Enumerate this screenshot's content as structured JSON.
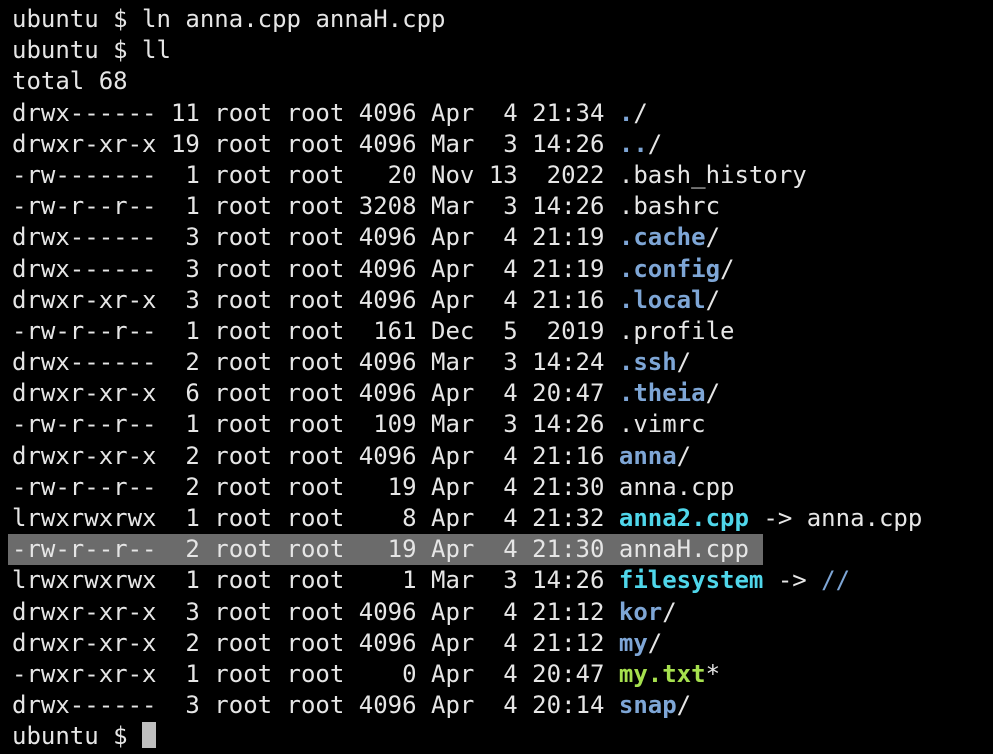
{
  "terminal": {
    "prompt": "ubuntu $",
    "commands": [
      "ln anna.cpp annaH.cpp",
      "ll"
    ],
    "total": "total 68",
    "colors": {
      "background": "#000000",
      "text": "#e6e6e6",
      "directory": "#7ea6d6",
      "symlink": "#4fd6ea",
      "executable": "#a6e04e",
      "selection": "#6b6b6b"
    },
    "entries": [
      {
        "meta": "drwx------ 11 root root 4096 Apr  4 21:34 ",
        "name": ".",
        "suffix": "/",
        "type": "dir"
      },
      {
        "meta": "drwxr-xr-x 19 root root 4096 Mar  3 14:26 ",
        "name": "..",
        "suffix": "/",
        "type": "dir"
      },
      {
        "meta": "-rw-------  1 root root   20 Nov 13  2022 ",
        "name": ".bash_history",
        "suffix": "",
        "type": "file"
      },
      {
        "meta": "-rw-r--r--  1 root root 3208 Mar  3 14:26 ",
        "name": ".bashrc",
        "suffix": "",
        "type": "file"
      },
      {
        "meta": "drwx------  3 root root 4096 Apr  4 21:19 ",
        "name": ".cache",
        "suffix": "/",
        "type": "dir"
      },
      {
        "meta": "drwx------  3 root root 4096 Apr  4 21:19 ",
        "name": ".config",
        "suffix": "/",
        "type": "dir"
      },
      {
        "meta": "drwxr-xr-x  3 root root 4096 Apr  4 21:16 ",
        "name": ".local",
        "suffix": "/",
        "type": "dir"
      },
      {
        "meta": "-rw-r--r--  1 root root  161 Dec  5  2019 ",
        "name": ".profile",
        "suffix": "",
        "type": "file"
      },
      {
        "meta": "drwx------  2 root root 4096 Mar  3 14:24 ",
        "name": ".ssh",
        "suffix": "/",
        "type": "dir"
      },
      {
        "meta": "drwxr-xr-x  6 root root 4096 Apr  4 20:47 ",
        "name": ".theia",
        "suffix": "/",
        "type": "dir"
      },
      {
        "meta": "-rw-r--r--  1 root root  109 Mar  3 14:26 ",
        "name": ".vimrc",
        "suffix": "",
        "type": "file"
      },
      {
        "meta": "drwxr-xr-x  2 root root 4096 Apr  4 21:16 ",
        "name": "anna",
        "suffix": "/",
        "type": "dir"
      },
      {
        "meta": "-rw-r--r--  2 root root   19 Apr  4 21:30 ",
        "name": "anna.cpp",
        "suffix": "",
        "type": "file"
      },
      {
        "meta": "lrwxrwxrwx  1 root root    8 Apr  4 21:32 ",
        "name": "anna2.cpp",
        "suffix": " -> ",
        "target": "anna.cpp",
        "target_type": "file",
        "type": "link"
      },
      {
        "meta": "-rw-r--r--  2 root root   19 Apr  4 21:30 ",
        "name": "annaH.cpp",
        "suffix": "",
        "type": "file",
        "selected": true
      },
      {
        "meta": "lrwxrwxrwx  1 root root    1 Mar  3 14:26 ",
        "name": "filesystem",
        "suffix": " -> ",
        "target": "//",
        "target_type": "dir",
        "type": "link"
      },
      {
        "meta": "drwxr-xr-x  3 root root 4096 Apr  4 21:12 ",
        "name": "kor",
        "suffix": "/",
        "type": "dir"
      },
      {
        "meta": "drwxr-xr-x  2 root root 4096 Apr  4 21:12 ",
        "name": "my",
        "suffix": "/",
        "type": "dir"
      },
      {
        "meta": "-rwxr-xr-x  1 root root    0 Apr  4 20:47 ",
        "name": "my.txt",
        "suffix": "*",
        "type": "exec"
      },
      {
        "meta": "drwx------  3 root root 4096 Apr  4 20:14 ",
        "name": "snap",
        "suffix": "/",
        "type": "dir"
      }
    ]
  }
}
